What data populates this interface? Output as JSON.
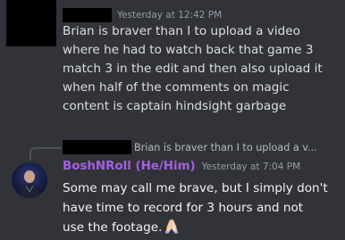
{
  "message1": {
    "timestamp": "Yesterday at 12:42 PM",
    "lines": [
      "Brian is braver than I to upload a video",
      "where he had to watch back that game 3",
      "match 3 in the edit and then also upload it",
      "when half of the comments on magic",
      "content is captain hindsight garbage"
    ]
  },
  "message2": {
    "reply_preview": "Brian is braver than I to upload a v...",
    "username": "BoshNRoll (He/Him)",
    "username_color": "#a460e0",
    "timestamp": "Yesterday at 7:04 PM",
    "lines": [
      "Some may call me brave, but I simply don't",
      "have time to record for 3 hours and not",
      "use the footage."
    ],
    "emoji": "folded-hands-emoji"
  }
}
